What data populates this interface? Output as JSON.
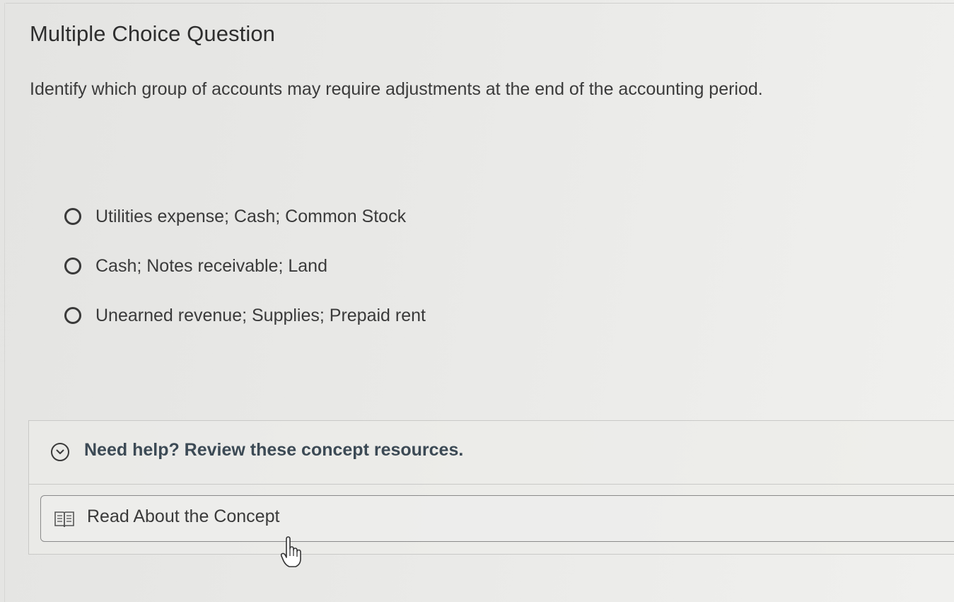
{
  "question": {
    "type_label": "Multiple Choice Question",
    "prompt": "Identify which group of accounts may require adjustments at the end of the accounting period."
  },
  "options": [
    {
      "label": "Utilities expense; Cash; Common Stock",
      "selected": false
    },
    {
      "label": "Cash; Notes receivable; Land",
      "selected": false
    },
    {
      "label": "Unearned revenue; Supplies; Prepaid rent",
      "selected": false
    }
  ],
  "help": {
    "title": "Need help? Review these concept resources.",
    "icon": "chevron-down-circle-icon",
    "resources": [
      {
        "label": "Read About the Concept",
        "icon": "book-icon"
      }
    ]
  },
  "cursor": {
    "icon": "hand-pointer-icon"
  }
}
